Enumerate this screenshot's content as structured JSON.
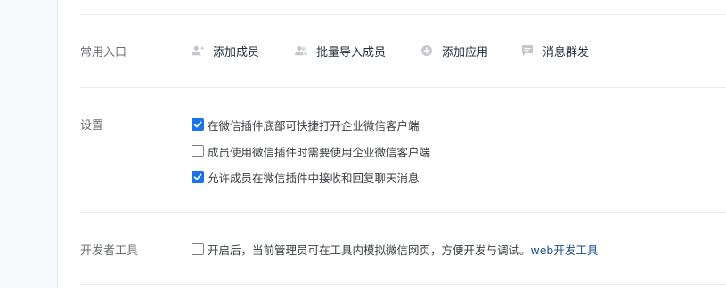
{
  "sections": {
    "common_entries": {
      "label": "常用入口",
      "items": [
        {
          "label": "添加成员",
          "icon": "add-member-icon"
        },
        {
          "label": "批量导入成员",
          "icon": "bulk-import-members-icon"
        },
        {
          "label": "添加应用",
          "icon": "add-app-icon"
        },
        {
          "label": "消息群发",
          "icon": "message-broadcast-icon"
        }
      ]
    },
    "settings": {
      "label": "设置",
      "options": [
        {
          "label": "在微信插件底部可快捷打开企业微信客户端",
          "checked": true
        },
        {
          "label": "成员使用微信插件时需要使用企业微信客户端",
          "checked": false
        },
        {
          "label": "允许成员在微信插件中接收和回复聊天消息",
          "checked": true
        }
      ]
    },
    "dev_tools": {
      "label": "开发者工具",
      "option_text": "开启后，当前管理员可在工具内模拟微信网页，方便开发与调试。",
      "option_checked": false,
      "link": "web开发工具"
    }
  },
  "colors": {
    "accent": "#1a73e8",
    "link": "#1a4f8b",
    "divider": "#e8eaed",
    "icon": "#c4c8ce"
  }
}
